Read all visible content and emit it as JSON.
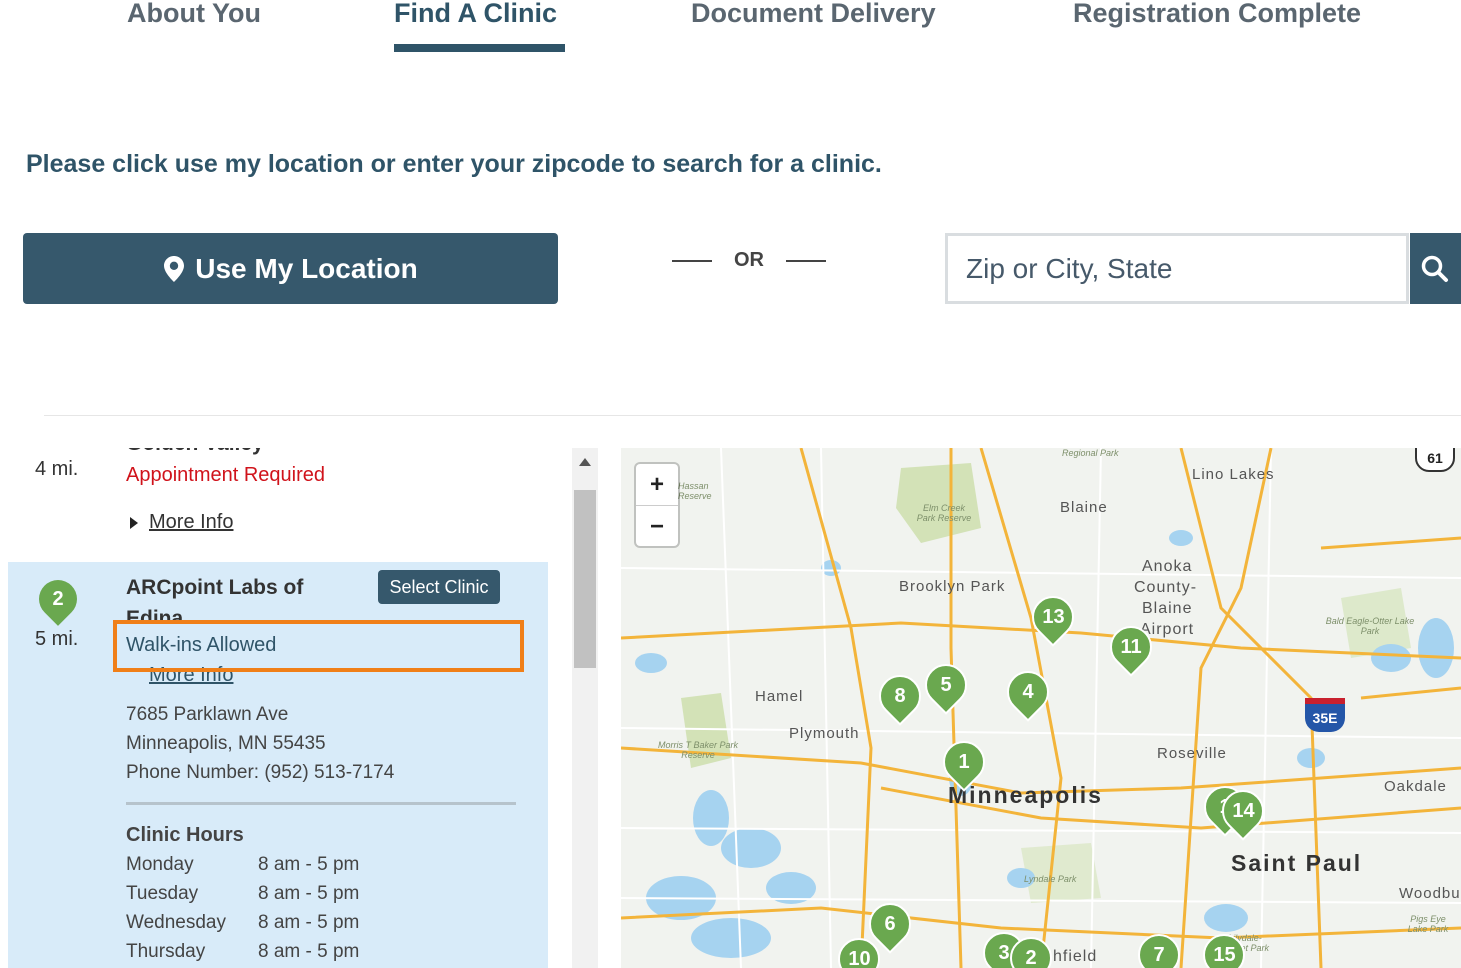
{
  "steps": {
    "about": "About You",
    "find_clinic": "Find A Clinic",
    "document_delivery": "Document Delivery",
    "registration_complete": "Registration Complete"
  },
  "instruction": "Please click use my location or enter your zipcode to search for a clinic.",
  "use_location_label": "Use My Location",
  "or_label": "OR",
  "search": {
    "placeholder": "Zip or City, State"
  },
  "list": {
    "prev_clinic": {
      "partial_name": "Golden Valley",
      "distance": "4 mi.",
      "appointment": "Appointment Required",
      "more_info": "More Info"
    },
    "selected_clinic": {
      "number": "2",
      "name": "ARCpoint Labs of Edina",
      "select_label": "Select Clinic",
      "distance": "5 mi.",
      "walkin": "Walk-ins Allowed",
      "more_info": "More Info",
      "address_line1": "7685 Parklawn Ave",
      "address_line2": "Minneapolis, MN 55435",
      "phone": "Phone Number: (952) 513-7174",
      "hours_title": "Clinic Hours",
      "hours": [
        {
          "day": "Monday",
          "time": "8 am - 5 pm"
        },
        {
          "day": "Tuesday",
          "time": "8 am - 5 pm"
        },
        {
          "day": "Wednesday",
          "time": "8 am - 5 pm"
        },
        {
          "day": "Thursday",
          "time": "8 am - 5 pm"
        }
      ]
    }
  },
  "map": {
    "zoom_in": "+",
    "zoom_out": "−",
    "labels": {
      "regional_park": "Regional Park",
      "lino_lakes": "Lino Lakes",
      "blaine": "Blaine",
      "hassan": "Hassan Reserve",
      "elm_creek": "Elm Creek Park Reserve",
      "brooklyn_park": "Brooklyn Park",
      "anoka": "Anoka",
      "county": "County-",
      "blaine2": "Blaine",
      "airport": "Airport",
      "bald_eagle": "Bald Eagle-Otter Lake Park",
      "hamel": "Hamel",
      "plymouth": "Plymouth",
      "morris": "Morris T Baker Park Reserve",
      "roseville": "Roseville",
      "oakdale": "Oakdale",
      "minneapolis": "Minneapolis",
      "saint_paul": "Saint Paul",
      "woodbury": "Woodbu",
      "lyndale": "Lyndale Park",
      "pigs_eye": "Pigs Eye Lake Park",
      "lilydale": "Lilydale-Harriet Park",
      "richfield": "chfield",
      "highway_61": "61",
      "highway_35e": "35E"
    },
    "markers": [
      "13",
      "11",
      "5",
      "8",
      "4",
      "1",
      "1",
      "14",
      "6",
      "10",
      "3",
      "2",
      "7",
      "15"
    ]
  },
  "colors": {
    "primary": "#36586c",
    "marker": "#6aa84f",
    "highlight": "#f07f18",
    "appointment": "#d0131b",
    "selected_bg": "#d8ebf9"
  }
}
